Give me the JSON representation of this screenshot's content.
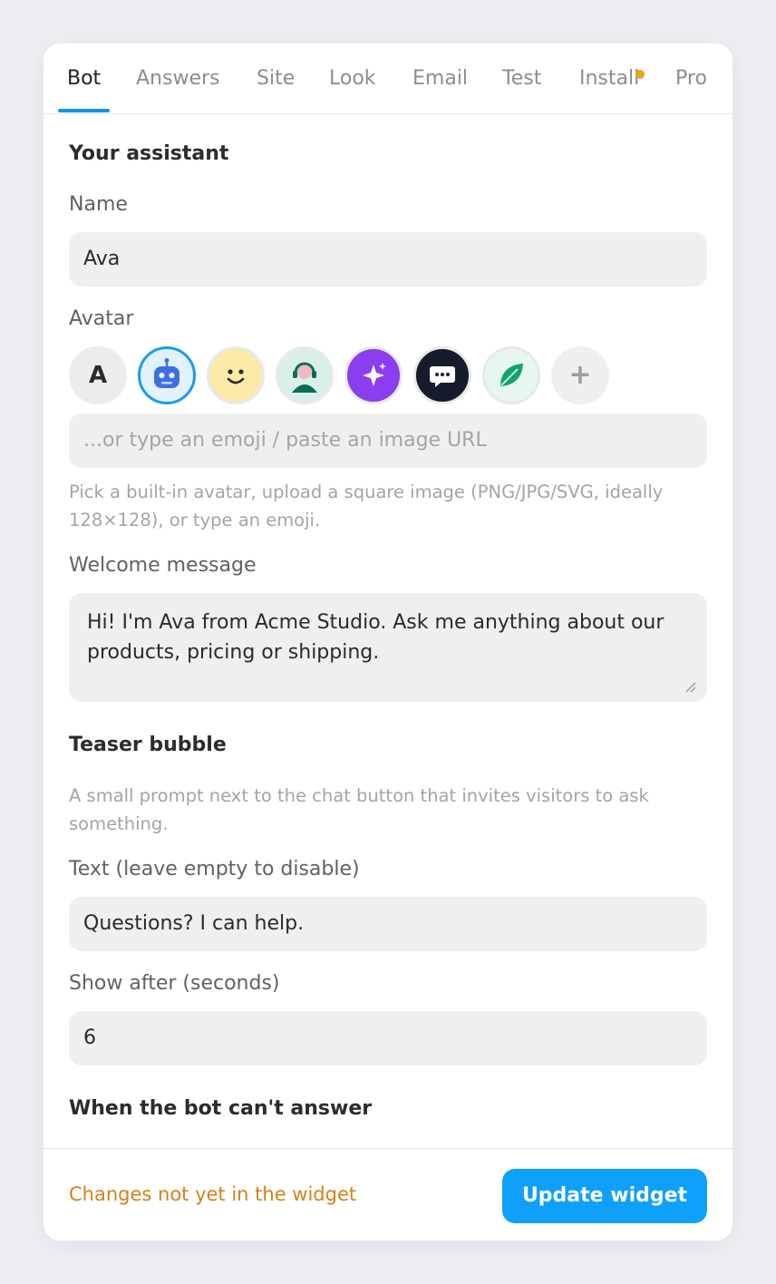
{
  "tabs": [
    {
      "label": "Bot"
    },
    {
      "label": "Answers"
    },
    {
      "label": "Site"
    },
    {
      "label": "Look"
    },
    {
      "label": "Email"
    },
    {
      "label": "Test"
    },
    {
      "label": "Install"
    },
    {
      "label": "Pro"
    }
  ],
  "active_tab": "Bot",
  "assistant": {
    "heading": "Your assistant",
    "name_label": "Name",
    "name_value": "Ava",
    "avatar_label": "Avatar",
    "avatar_letter": "A",
    "avatar_add": "+",
    "avatar_options": [
      "letter",
      "robot-icon",
      "smiley-icon",
      "agent-icon",
      "sparkle-icon",
      "chat-bubble-icon",
      "leaf-icon",
      "add-icon"
    ],
    "avatar_input_placeholder": "...or type an emoji / paste an image URL",
    "avatar_help": "Pick a built-in avatar, upload a square image (PNG/JPG/SVG, ideally 128×128), or type an emoji.",
    "welcome_label": "Welcome message",
    "welcome_value": "Hi! I'm Ava from Acme Studio. Ask me anything about our products, pricing or shipping."
  },
  "teaser": {
    "heading": "Teaser bubble",
    "help": "A small prompt next to the chat button that invites visitors to ask something.",
    "text_label": "Text (leave empty to disable)",
    "text_value": "Questions? I can help.",
    "delay_label": "Show after (seconds)",
    "delay_value": "6"
  },
  "fallback": {
    "heading": "When the bot can't answer"
  },
  "footer": {
    "status": "Changes not yet in the widget",
    "update_label": "Update widget"
  },
  "colors": {
    "accent": "#1493f0",
    "primary_button": "#0ea0fa",
    "warning_text": "#d6801a",
    "notification_dot": "#efa21b"
  }
}
